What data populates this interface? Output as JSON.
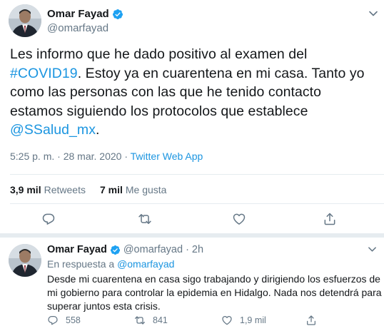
{
  "main_tweet": {
    "display_name": "Omar Fayad",
    "handle": "@omarfayad",
    "text_parts": {
      "p1": "Les informo que he dado positivo al examen del ",
      "hashtag": "#COVID19",
      "p2": ". Estoy ya en cuarentena en mi casa. Tanto yo como las personas con las que he tenido contacto estamos siguiendo los protocolos que establece ",
      "mention": "@SSalud_mx",
      "p3": "."
    },
    "time": "5:25 p. m.",
    "separator": "·",
    "date": "28 mar. 2020",
    "app": "Twitter Web App",
    "retweets_count": "3,9 mil",
    "retweets_label": "Retweets",
    "likes_count": "7 mil",
    "likes_label": "Me gusta"
  },
  "reply_tweet": {
    "display_name": "Omar Fayad",
    "handle": "@omarfayad",
    "dot": "·",
    "time": "2h",
    "in_reply_label": "En respuesta a ",
    "in_reply_handle": "@omarfayad",
    "text": "Desde mi cuarentena en casa sigo trabajando y dirigiendo los esfuerzos de mi gobierno para controlar la epidemia en Hidalgo. Nada nos detendrá para superar juntos esta crisis.",
    "reply_count": "558",
    "retweet_count": "841",
    "like_count": "1,9 mil"
  },
  "colors": {
    "link": "#1b95e0",
    "muted": "#657786",
    "text": "#14171a",
    "divider": "#e6ecf0",
    "verified": "#1da1f2"
  },
  "icons": [
    "verified-badge-icon",
    "chevron-down-icon",
    "reply-icon",
    "retweet-icon",
    "like-icon",
    "share-icon"
  ]
}
